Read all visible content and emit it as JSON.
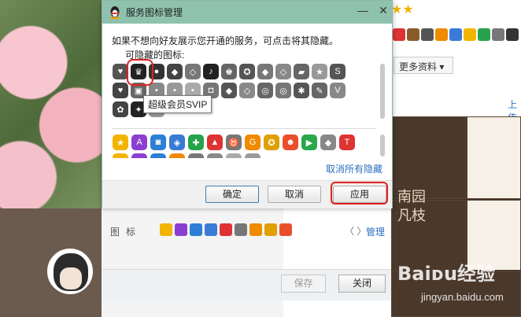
{
  "dialog": {
    "title": "服务图标管理",
    "description": "如果不想向好友展示您开通的服务，可点击将其隐藏。",
    "hideable_label": "可隐藏的图标:",
    "tooltip": "超级会员SVIP",
    "cancel_all_hide": "取消所有隐藏",
    "buttons": {
      "ok": "确定",
      "cancel": "取消",
      "apply": "应用"
    },
    "minimize_glyph": "—",
    "close_glyph": "✕"
  },
  "background": {
    "more_info": "更多资料 ▾",
    "up_link": "上传",
    "icons_label": "图标",
    "manage": "管理",
    "nav": "〈 〉",
    "save": "保存",
    "close": "关闭",
    "watermark": "Baiᴅu经验",
    "watermark_url": "jingyan.baidu.com",
    "tile_text_1": "南园",
    "tile_text_2": "凡枝"
  },
  "colors": {
    "titlebar": "#8fc2ae",
    "highlight_red": "#e02020",
    "link_blue": "#2b6fc0"
  }
}
